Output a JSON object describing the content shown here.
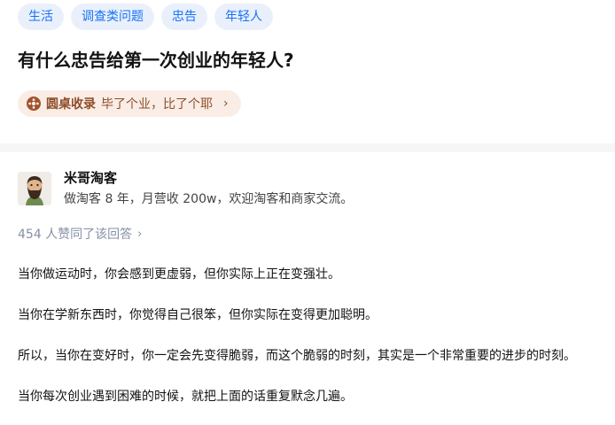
{
  "tags": [
    "生活",
    "调查类问题",
    "忠告",
    "年轻人"
  ],
  "question": {
    "title": "有什么忠告给第一次创业的年轻人?"
  },
  "roundtable": {
    "label": "圆桌收录",
    "description": "毕了个业，比了个耶",
    "arrow": "›"
  },
  "author": {
    "name": "米哥淘客",
    "bio": "做淘客 8 年，月营收 200w，欢迎淘客和商家交流。"
  },
  "voters": {
    "text": "454 人赞同了该回答",
    "arrow": "›"
  },
  "answer": {
    "paragraphs": [
      "当你做运动时，你会感到更虚弱，但你实际上正在变强壮。",
      "当你在学新东西时，你觉得自己很笨，但你实际在变得更加聪明。",
      "所以，当你在变好时，你一定会先变得脆弱，而这个脆弱的时刻，其实是一个非常重要的进步的时刻。",
      "当你每次创业遇到困难的时候，就把上面的话重复默念几遍。"
    ]
  },
  "colors": {
    "tag_bg": "#eaf0fb",
    "tag_text": "#1772f6",
    "roundtable_bg": "#f9ede6",
    "roundtable_text": "#8e4d29",
    "muted": "#8590a6"
  },
  "icons": {
    "roundtable": "roundtable-icon",
    "avatar": "bearded-man-avatar"
  }
}
